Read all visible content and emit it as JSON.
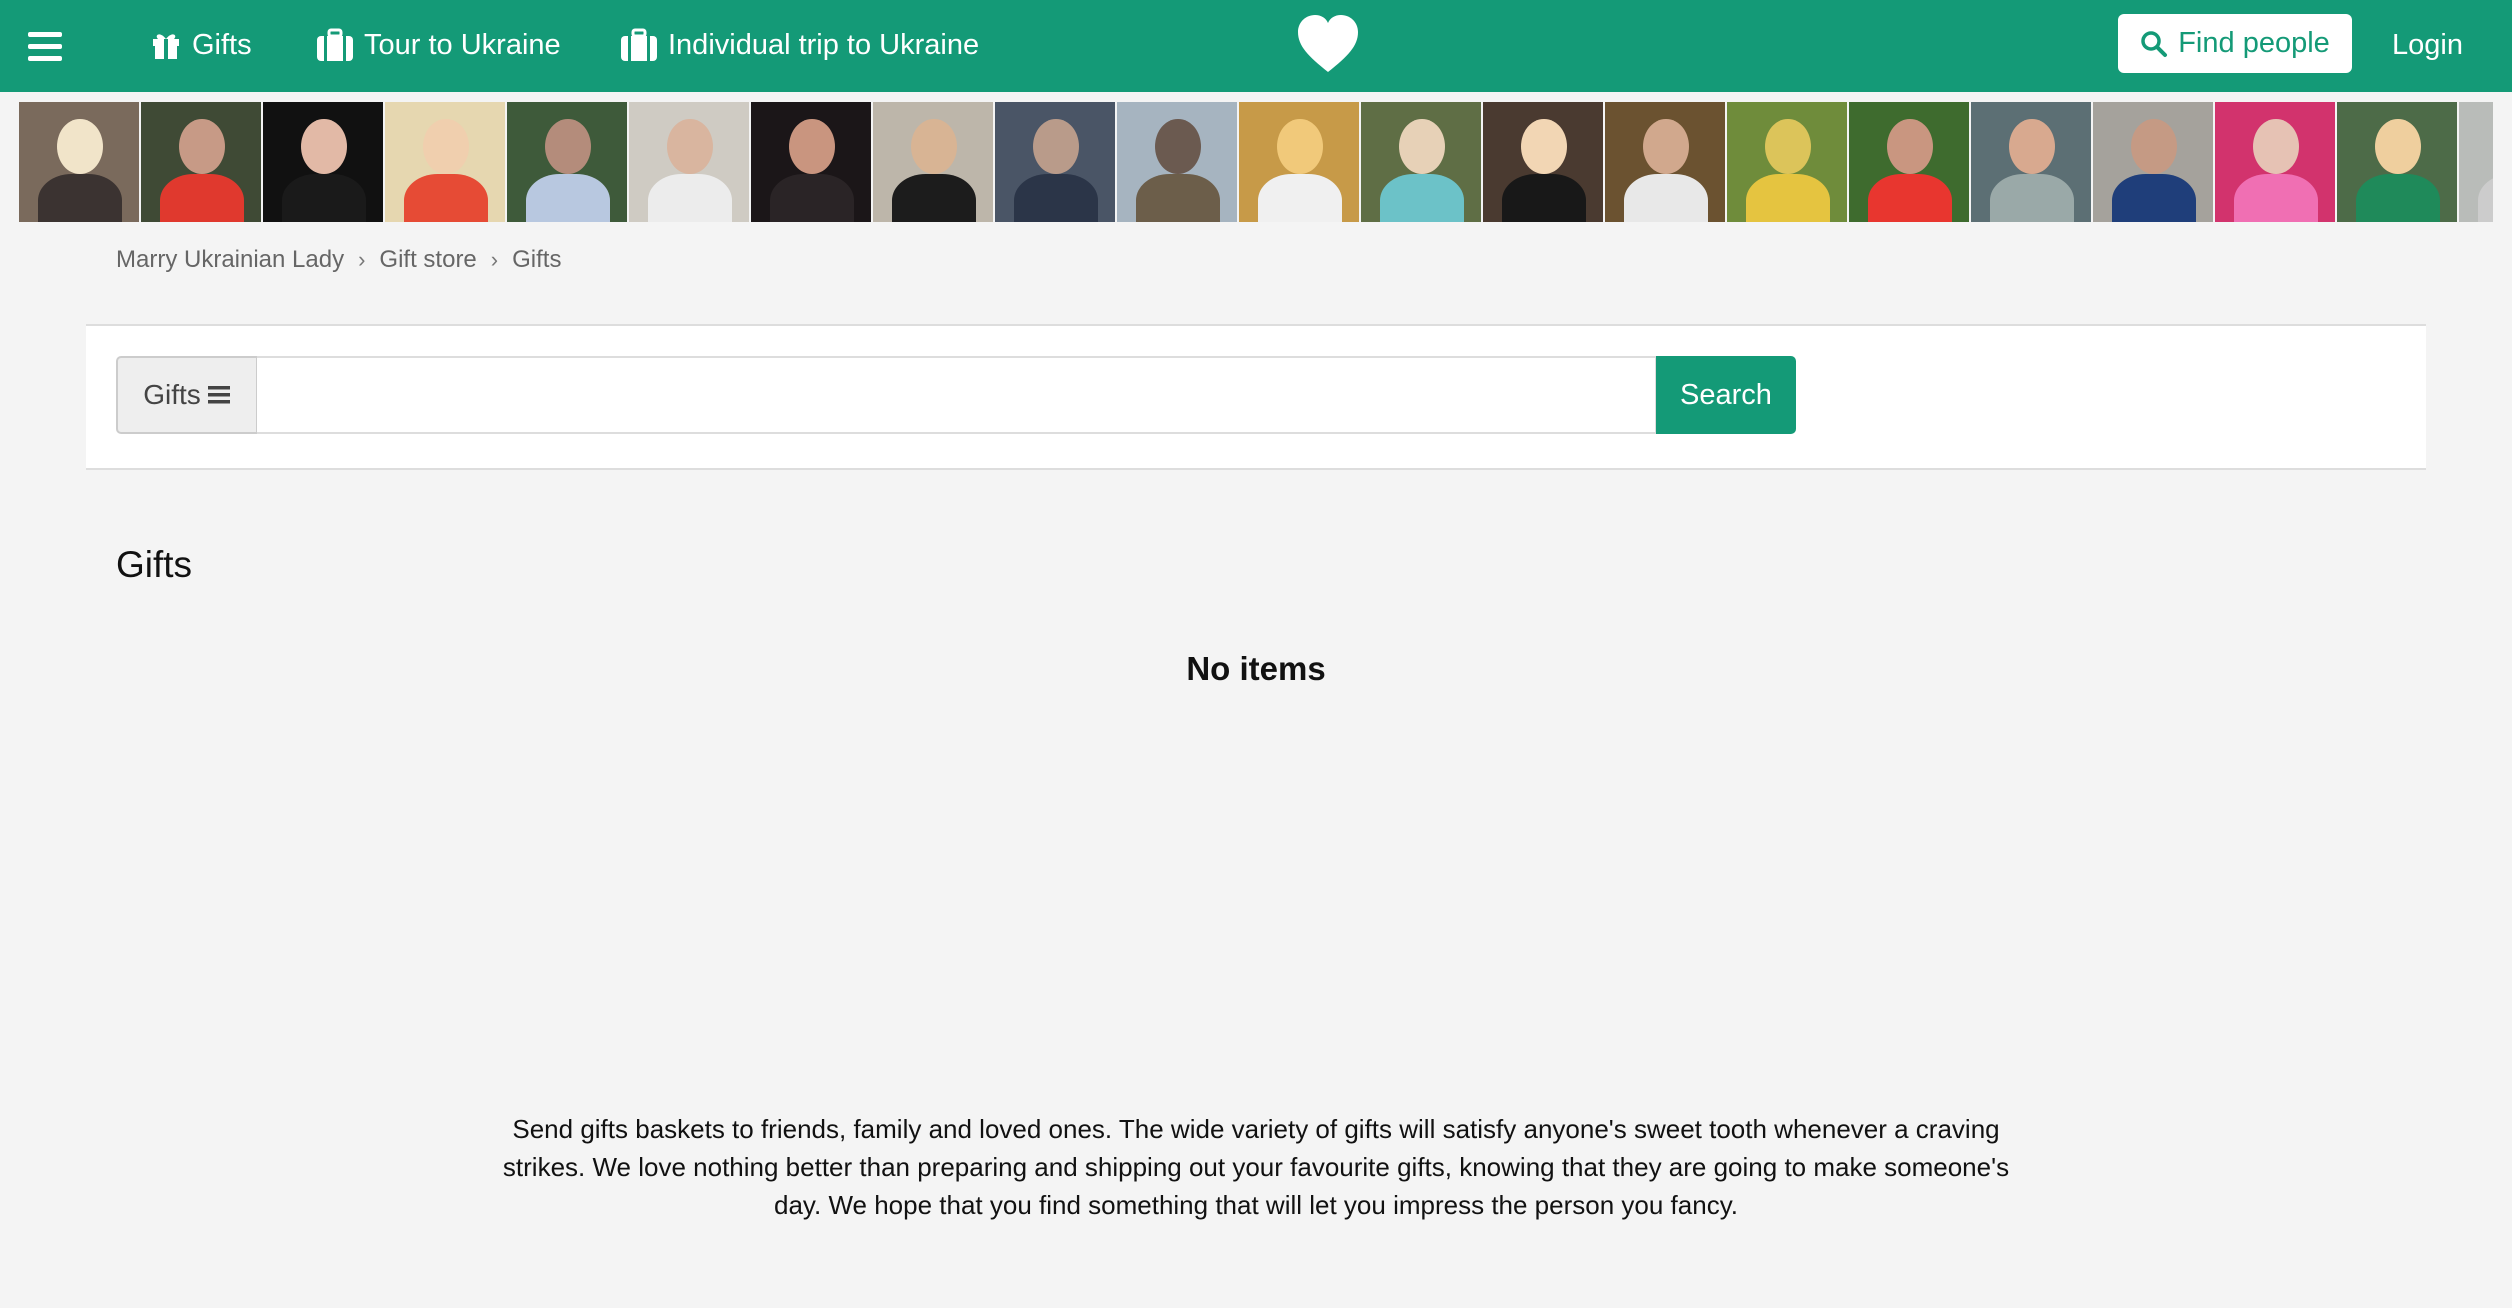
{
  "nav": {
    "gifts_label": "Gifts",
    "tour_label": "Tour to Ukraine",
    "trip_label": "Individual trip to Ukraine",
    "find_label": "Find people",
    "login_label": "Login"
  },
  "colors": {
    "brand": "#149a77",
    "background": "#f4f4f4"
  },
  "photos": [
    {
      "bg": "#7a6a5c",
      "head": "#f1e4c9",
      "body": "#3b3331"
    },
    {
      "bg": "#3f4a35",
      "head": "#c79a86",
      "body": "#e0392e"
    },
    {
      "bg": "#111111",
      "head": "#e2b9a6",
      "body": "#1a1a1a"
    },
    {
      "bg": "#e6d7b0",
      "head": "#f0cfae",
      "body": "#e64b35"
    },
    {
      "bg": "#3e5a3a",
      "head": "#b48c7b",
      "body": "#b8c8e0"
    },
    {
      "bg": "#cfcbc3",
      "head": "#d9b59f",
      "body": "#ececec"
    },
    {
      "bg": "#1b1618",
      "head": "#c9957f",
      "body": "#2a2426"
    },
    {
      "bg": "#bdb6aa",
      "head": "#d8b494",
      "body": "#1c1c1c"
    },
    {
      "bg": "#4a5566",
      "head": "#b99b8a",
      "body": "#2b3548"
    },
    {
      "bg": "#a6b4c0",
      "head": "#6b5a50",
      "body": "#6c5e4a"
    },
    {
      "bg": "#c79a48",
      "head": "#f1c97a",
      "body": "#f0f0f0"
    },
    {
      "bg": "#5f6e45",
      "head": "#e7d1b7",
      "body": "#6cc2c8"
    },
    {
      "bg": "#4a3a30",
      "head": "#f2d6b4",
      "body": "#181818"
    },
    {
      "bg": "#6b5230",
      "head": "#d1a88d",
      "body": "#e8e8e8"
    },
    {
      "bg": "#6f8c3b",
      "head": "#dcc45a",
      "body": "#e5c440"
    },
    {
      "bg": "#3e6b2e",
      "head": "#c99680",
      "body": "#e8362f"
    },
    {
      "bg": "#5c6f74",
      "head": "#d8a98f",
      "body": "#9aa9a8"
    },
    {
      "bg": "#a5a29c",
      "head": "#c59a84",
      "body": "#1f3e7a"
    },
    {
      "bg": "#d2336d",
      "head": "#e6c2b4",
      "body": "#f06fb3"
    },
    {
      "bg": "#4d6b48",
      "head": "#efcf9e",
      "body": "#1f8a5a"
    },
    {
      "bg": "#b9bcb9",
      "head": "#e0c3b3",
      "body": "#cccccc"
    }
  ],
  "breadcrumb": [
    "Marry Ukrainian Lady",
    "Gift store",
    "Gifts"
  ],
  "search": {
    "category_label": "Gifts",
    "placeholder": "",
    "value": "",
    "button_label": "Search"
  },
  "main": {
    "title": "Gifts",
    "empty_label": "No items"
  },
  "description": "Send gifts baskets to friends, family and loved ones. The wide variety of gifts will satisfy anyone's sweet tooth whenever a craving strikes. We love nothing better than preparing and shipping out your favourite gifts, knowing that they are going to make someone's day. We hope that you find something that will let you impress the person you fancy."
}
